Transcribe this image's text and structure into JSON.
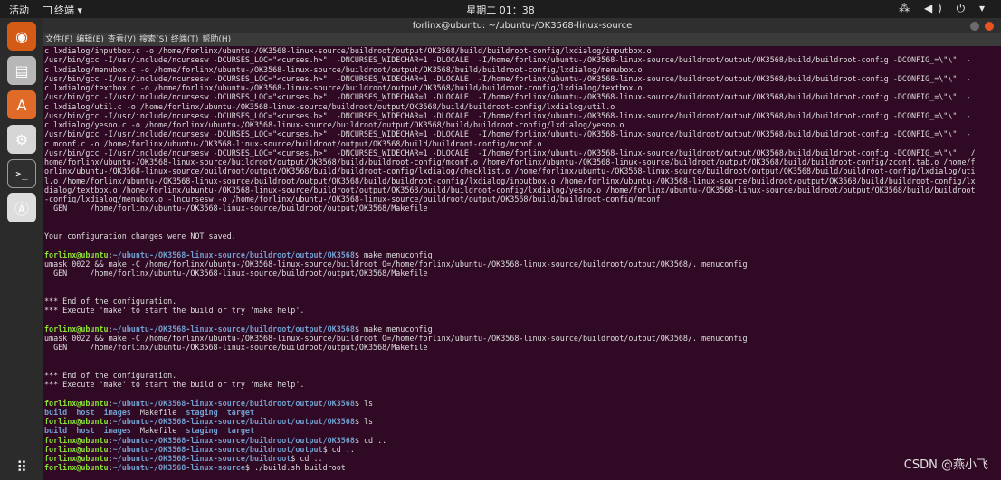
{
  "topbar": {
    "activities": "活动",
    "app_name": "终端 ▾",
    "clock": "星期二 01：38",
    "tray": "⁂ ◀) ⏻ ▾"
  },
  "dock": {
    "items": [
      {
        "icon": "firefox-icon",
        "glyph": "◉",
        "bg": "#d45b15"
      },
      {
        "icon": "files-icon",
        "glyph": "▤",
        "bg": "#b7b7b7"
      },
      {
        "icon": "software-center-icon",
        "glyph": "A",
        "bg": "#e06b29"
      },
      {
        "icon": "settings-icon",
        "glyph": "⚙",
        "bg": "#d6d6d6"
      },
      {
        "icon": "terminal-icon",
        "glyph": ">_",
        "bg": "#2f2f2f"
      },
      {
        "icon": "software-updater-icon",
        "glyph": "Ⓐ",
        "bg": "#dddddd"
      },
      {
        "icon": "show-applications-icon",
        "glyph": "⠿",
        "bg": "transparent"
      }
    ]
  },
  "window": {
    "title": "forlinx@ubuntu: ~/ubuntu-/OK3568-linux-source",
    "menu": [
      "文件(F)",
      "编辑(E)",
      "查看(V)",
      "搜索(S)",
      "终端(T)",
      "帮助(H)"
    ]
  },
  "terminal": {
    "lines": [
      [
        {
          "t": "c lxdialog/inputbox.c -o /home/forlinx/ubuntu-/OK3568-linux-source/buildroot/output/OK3568/build/buildroot-config/lxdialog/inputbox.o"
        }
      ],
      [
        {
          "t": "/usr/bin/gcc -I/usr/include/ncursesw -DCURSES_LOC=\"<curses.h>\"  -DNCURSES_WIDECHAR=1 -DLOCALE  -I/home/forlinx/ubuntu-/OK3568-linux-source/buildroot/output/OK3568/build/buildroot-config -DCONFIG_=\\\"\\\"  -"
        }
      ],
      [
        {
          "t": "c lxdialog/menubox.c -o /home/forlinx/ubuntu-/OK3568-linux-source/buildroot/output/OK3568/build/buildroot-config/lxdialog/menubox.o"
        }
      ],
      [
        {
          "t": "/usr/bin/gcc -I/usr/include/ncursesw -DCURSES_LOC=\"<curses.h>\"  -DNCURSES_WIDECHAR=1 -DLOCALE  -I/home/forlinx/ubuntu-/OK3568-linux-source/buildroot/output/OK3568/build/buildroot-config -DCONFIG_=\\\"\\\"  -"
        }
      ],
      [
        {
          "t": "c lxdialog/textbox.c -o /home/forlinx/ubuntu-/OK3568-linux-source/buildroot/output/OK3568/build/buildroot-config/lxdialog/textbox.o"
        }
      ],
      [
        {
          "t": "/usr/bin/gcc -I/usr/include/ncursesw -DCURSES_LOC=\"<curses.h>\"  -DNCURSES_WIDECHAR=1 -DLOCALE  -I/home/forlinx/ubuntu-/OK3568-linux-source/buildroot/output/OK3568/build/buildroot-config -DCONFIG_=\\\"\\\"  -"
        }
      ],
      [
        {
          "t": "c lxdialog/util.c -o /home/forlinx/ubuntu-/OK3568-linux-source/buildroot/output/OK3568/build/buildroot-config/lxdialog/util.o"
        }
      ],
      [
        {
          "t": "/usr/bin/gcc -I/usr/include/ncursesw -DCURSES_LOC=\"<curses.h>\"  -DNCURSES_WIDECHAR=1 -DLOCALE  -I/home/forlinx/ubuntu-/OK3568-linux-source/buildroot/output/OK3568/build/buildroot-config -DCONFIG_=\\\"\\\"  -"
        }
      ],
      [
        {
          "t": "c lxdialog/yesno.c -o /home/forlinx/ubuntu-/OK3568-linux-source/buildroot/output/OK3568/build/buildroot-config/lxdialog/yesno.o"
        }
      ],
      [
        {
          "t": "/usr/bin/gcc -I/usr/include/ncursesw -DCURSES_LOC=\"<curses.h>\"  -DNCURSES_WIDECHAR=1 -DLOCALE  -I/home/forlinx/ubuntu-/OK3568-linux-source/buildroot/output/OK3568/build/buildroot-config -DCONFIG_=\\\"\\\"  -"
        }
      ],
      [
        {
          "t": "c mconf.c -o /home/forlinx/ubuntu-/OK3568-linux-source/buildroot/output/OK3568/build/buildroot-config/mconf.o"
        }
      ],
      [
        {
          "t": "/usr/bin/gcc -I/usr/include/ncursesw -DCURSES_LOC=\"<curses.h>\"  -DNCURSES_WIDECHAR=1 -DLOCALE  -I/home/forlinx/ubuntu-/OK3568-linux-source/buildroot/output/OK3568/build/buildroot-config -DCONFIG_=\\\"\\\"   /"
        }
      ],
      [
        {
          "t": "home/forlinx/ubuntu-/OK3568-linux-source/buildroot/output/OK3568/build/buildroot-config/mconf.o /home/forlinx/ubuntu-/OK3568-linux-source/buildroot/output/OK3568/build/buildroot-config/zconf.tab.o /home/f"
        }
      ],
      [
        {
          "t": "orlinx/ubuntu-/OK3568-linux-source/buildroot/output/OK3568/build/buildroot-config/lxdialog/checklist.o /home/forlinx/ubuntu-/OK3568-linux-source/buildroot/output/OK3568/build/buildroot-config/lxdialog/uti"
        }
      ],
      [
        {
          "t": "l.o /home/forlinx/ubuntu-/OK3568-linux-source/buildroot/output/OK3568/build/buildroot-config/lxdialog/inputbox.o /home/forlinx/ubuntu-/OK3568-linux-source/buildroot/output/OK3568/build/buildroot-config/lx"
        }
      ],
      [
        {
          "t": "dialog/textbox.o /home/forlinx/ubuntu-/OK3568-linux-source/buildroot/output/OK3568/build/buildroot-config/lxdialog/yesno.o /home/forlinx/ubuntu-/OK3568-linux-source/buildroot/output/OK3568/build/buildroot"
        }
      ],
      [
        {
          "t": "-config/lxdialog/menubox.o -lncursesw -o /home/forlinx/ubuntu-/OK3568-linux-source/buildroot/output/OK3568/build/buildroot-config/mconf"
        }
      ],
      [
        {
          "t": "  GEN     /home/forlinx/ubuntu-/OK3568-linux-source/buildroot/output/OK3568/Makefile"
        }
      ],
      [],
      [],
      [
        {
          "t": "Your configuration changes were NOT saved."
        }
      ],
      [],
      [
        {
          "t": "forlinx@ubuntu",
          "c": "prompt"
        },
        {
          "t": ":"
        },
        {
          "t": "~/ubuntu-/OK3568-linux-source/buildroot/output/OK3568",
          "c": "path"
        },
        {
          "t": "$ make menuconfig"
        }
      ],
      [
        {
          "t": "umask 0022 && make -C /home/forlinx/ubuntu-/OK3568-linux-source/buildroot O=/home/forlinx/ubuntu-/OK3568-linux-source/buildroot/output/OK3568/. menuconfig"
        }
      ],
      [
        {
          "t": "  GEN     /home/forlinx/ubuntu-/OK3568-linux-source/buildroot/output/OK3568/Makefile"
        }
      ],
      [],
      [],
      [
        {
          "t": "*** End of the configuration."
        }
      ],
      [
        {
          "t": "*** Execute 'make' to start the build or try 'make help'."
        }
      ],
      [],
      [
        {
          "t": "forlinx@ubuntu",
          "c": "prompt"
        },
        {
          "t": ":"
        },
        {
          "t": "~/ubuntu-/OK3568-linux-source/buildroot/output/OK3568",
          "c": "path"
        },
        {
          "t": "$ make menuconfig"
        }
      ],
      [
        {
          "t": "umask 0022 && make -C /home/forlinx/ubuntu-/OK3568-linux-source/buildroot O=/home/forlinx/ubuntu-/OK3568-linux-source/buildroot/output/OK3568/. menuconfig"
        }
      ],
      [
        {
          "t": "  GEN     /home/forlinx/ubuntu-/OK3568-linux-source/buildroot/output/OK3568/Makefile"
        }
      ],
      [],
      [],
      [
        {
          "t": "*** End of the configuration."
        }
      ],
      [
        {
          "t": "*** Execute 'make' to start the build or try 'make help'."
        }
      ],
      [],
      [
        {
          "t": "forlinx@ubuntu",
          "c": "prompt"
        },
        {
          "t": ":"
        },
        {
          "t": "~/ubuntu-/OK3568-linux-source/buildroot/output/OK3568",
          "c": "path"
        },
        {
          "t": "$ ls"
        }
      ],
      [
        {
          "t": "build",
          "c": "dir"
        },
        {
          "t": "  "
        },
        {
          "t": "host",
          "c": "dir"
        },
        {
          "t": "  "
        },
        {
          "t": "images",
          "c": "dir"
        },
        {
          "t": "  Makefile  "
        },
        {
          "t": "staging",
          "c": "dir"
        },
        {
          "t": "  "
        },
        {
          "t": "target",
          "c": "dir"
        }
      ],
      [
        {
          "t": "forlinx@ubuntu",
          "c": "prompt"
        },
        {
          "t": ":"
        },
        {
          "t": "~/ubuntu-/OK3568-linux-source/buildroot/output/OK3568",
          "c": "path"
        },
        {
          "t": "$ ls"
        }
      ],
      [
        {
          "t": "build",
          "c": "dir"
        },
        {
          "t": "  "
        },
        {
          "t": "host",
          "c": "dir"
        },
        {
          "t": "  "
        },
        {
          "t": "images",
          "c": "dir"
        },
        {
          "t": "  Makefile  "
        },
        {
          "t": "staging",
          "c": "dir"
        },
        {
          "t": "  "
        },
        {
          "t": "target",
          "c": "dir"
        }
      ],
      [
        {
          "t": "forlinx@ubuntu",
          "c": "prompt"
        },
        {
          "t": ":"
        },
        {
          "t": "~/ubuntu-/OK3568-linux-source/buildroot/output/OK3568",
          "c": "path"
        },
        {
          "t": "$ cd .."
        }
      ],
      [
        {
          "t": "forlinx@ubuntu",
          "c": "prompt"
        },
        {
          "t": ":"
        },
        {
          "t": "~/ubuntu-/OK3568-linux-source/buildroot/output",
          "c": "path"
        },
        {
          "t": "$ cd .."
        }
      ],
      [
        {
          "t": "forlinx@ubuntu",
          "c": "prompt"
        },
        {
          "t": ":"
        },
        {
          "t": "~/ubuntu-/OK3568-linux-source/buildroot",
          "c": "path"
        },
        {
          "t": "$ cd .."
        }
      ],
      [
        {
          "t": "forlinx@ubuntu",
          "c": "prompt"
        },
        {
          "t": ":"
        },
        {
          "t": "~/ubuntu-/OK3568-linux-source",
          "c": "path"
        },
        {
          "t": "$ ./build.sh buildroot"
        }
      ]
    ]
  },
  "watermark": "CSDN @燕小飞"
}
